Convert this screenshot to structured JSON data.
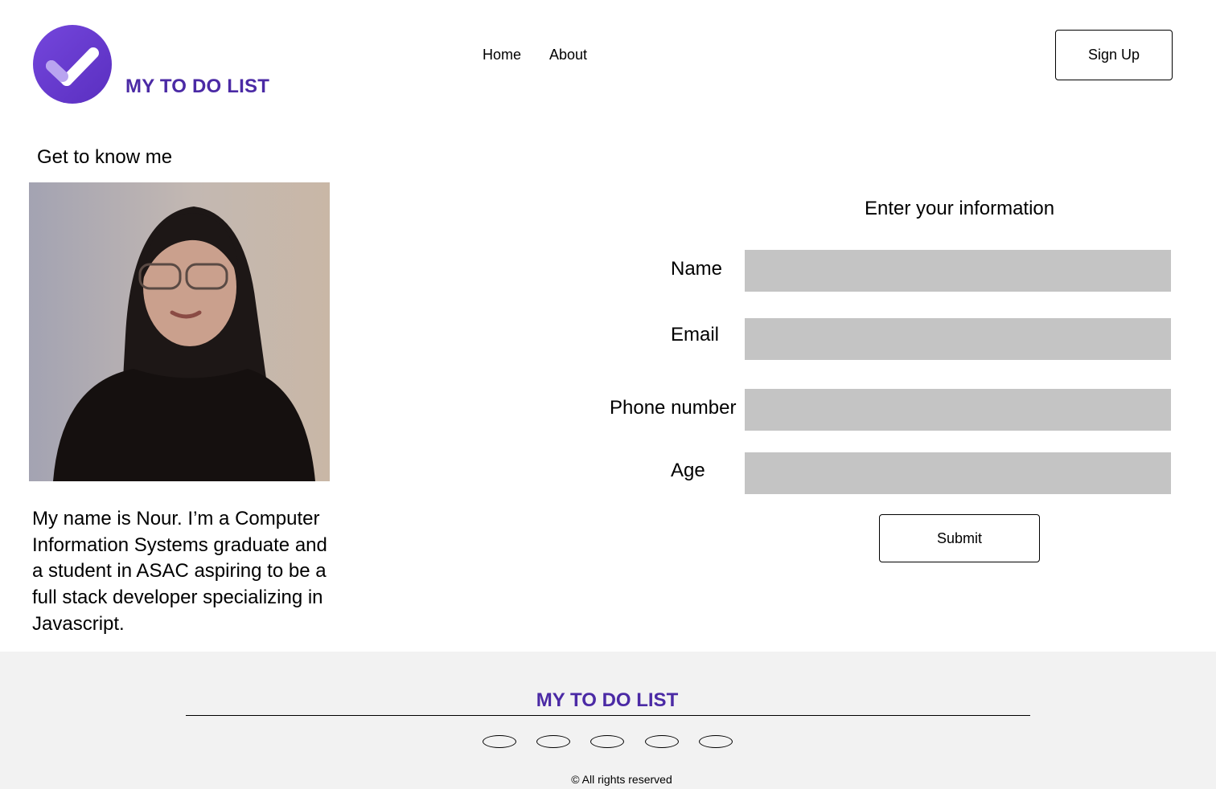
{
  "header": {
    "brand": "MY TO DO LIST",
    "logo_icon": "check-circle-icon",
    "nav": {
      "home": "Home",
      "about": "About"
    },
    "signup_label": "Sign Up"
  },
  "about": {
    "title": "Get to know me",
    "bio": "My name is Nour. I’m a Computer Information Systems graduate and a student in ASAC aspiring to be a full stack developer specializing in Javascript."
  },
  "form": {
    "title": "Enter your information",
    "fields": {
      "name": "Name",
      "email": "Email",
      "phone": "Phone number",
      "age": "Age"
    },
    "submit_label": "Submit"
  },
  "footer": {
    "brand": "MY TO DO LIST",
    "copyright": "© All rights reserved"
  },
  "colors": {
    "brand": "#4b2aa5",
    "logo_circle": "#6a3fd0",
    "input_bg": "#c4c4c4",
    "footer_bg": "#f2f2f2"
  }
}
